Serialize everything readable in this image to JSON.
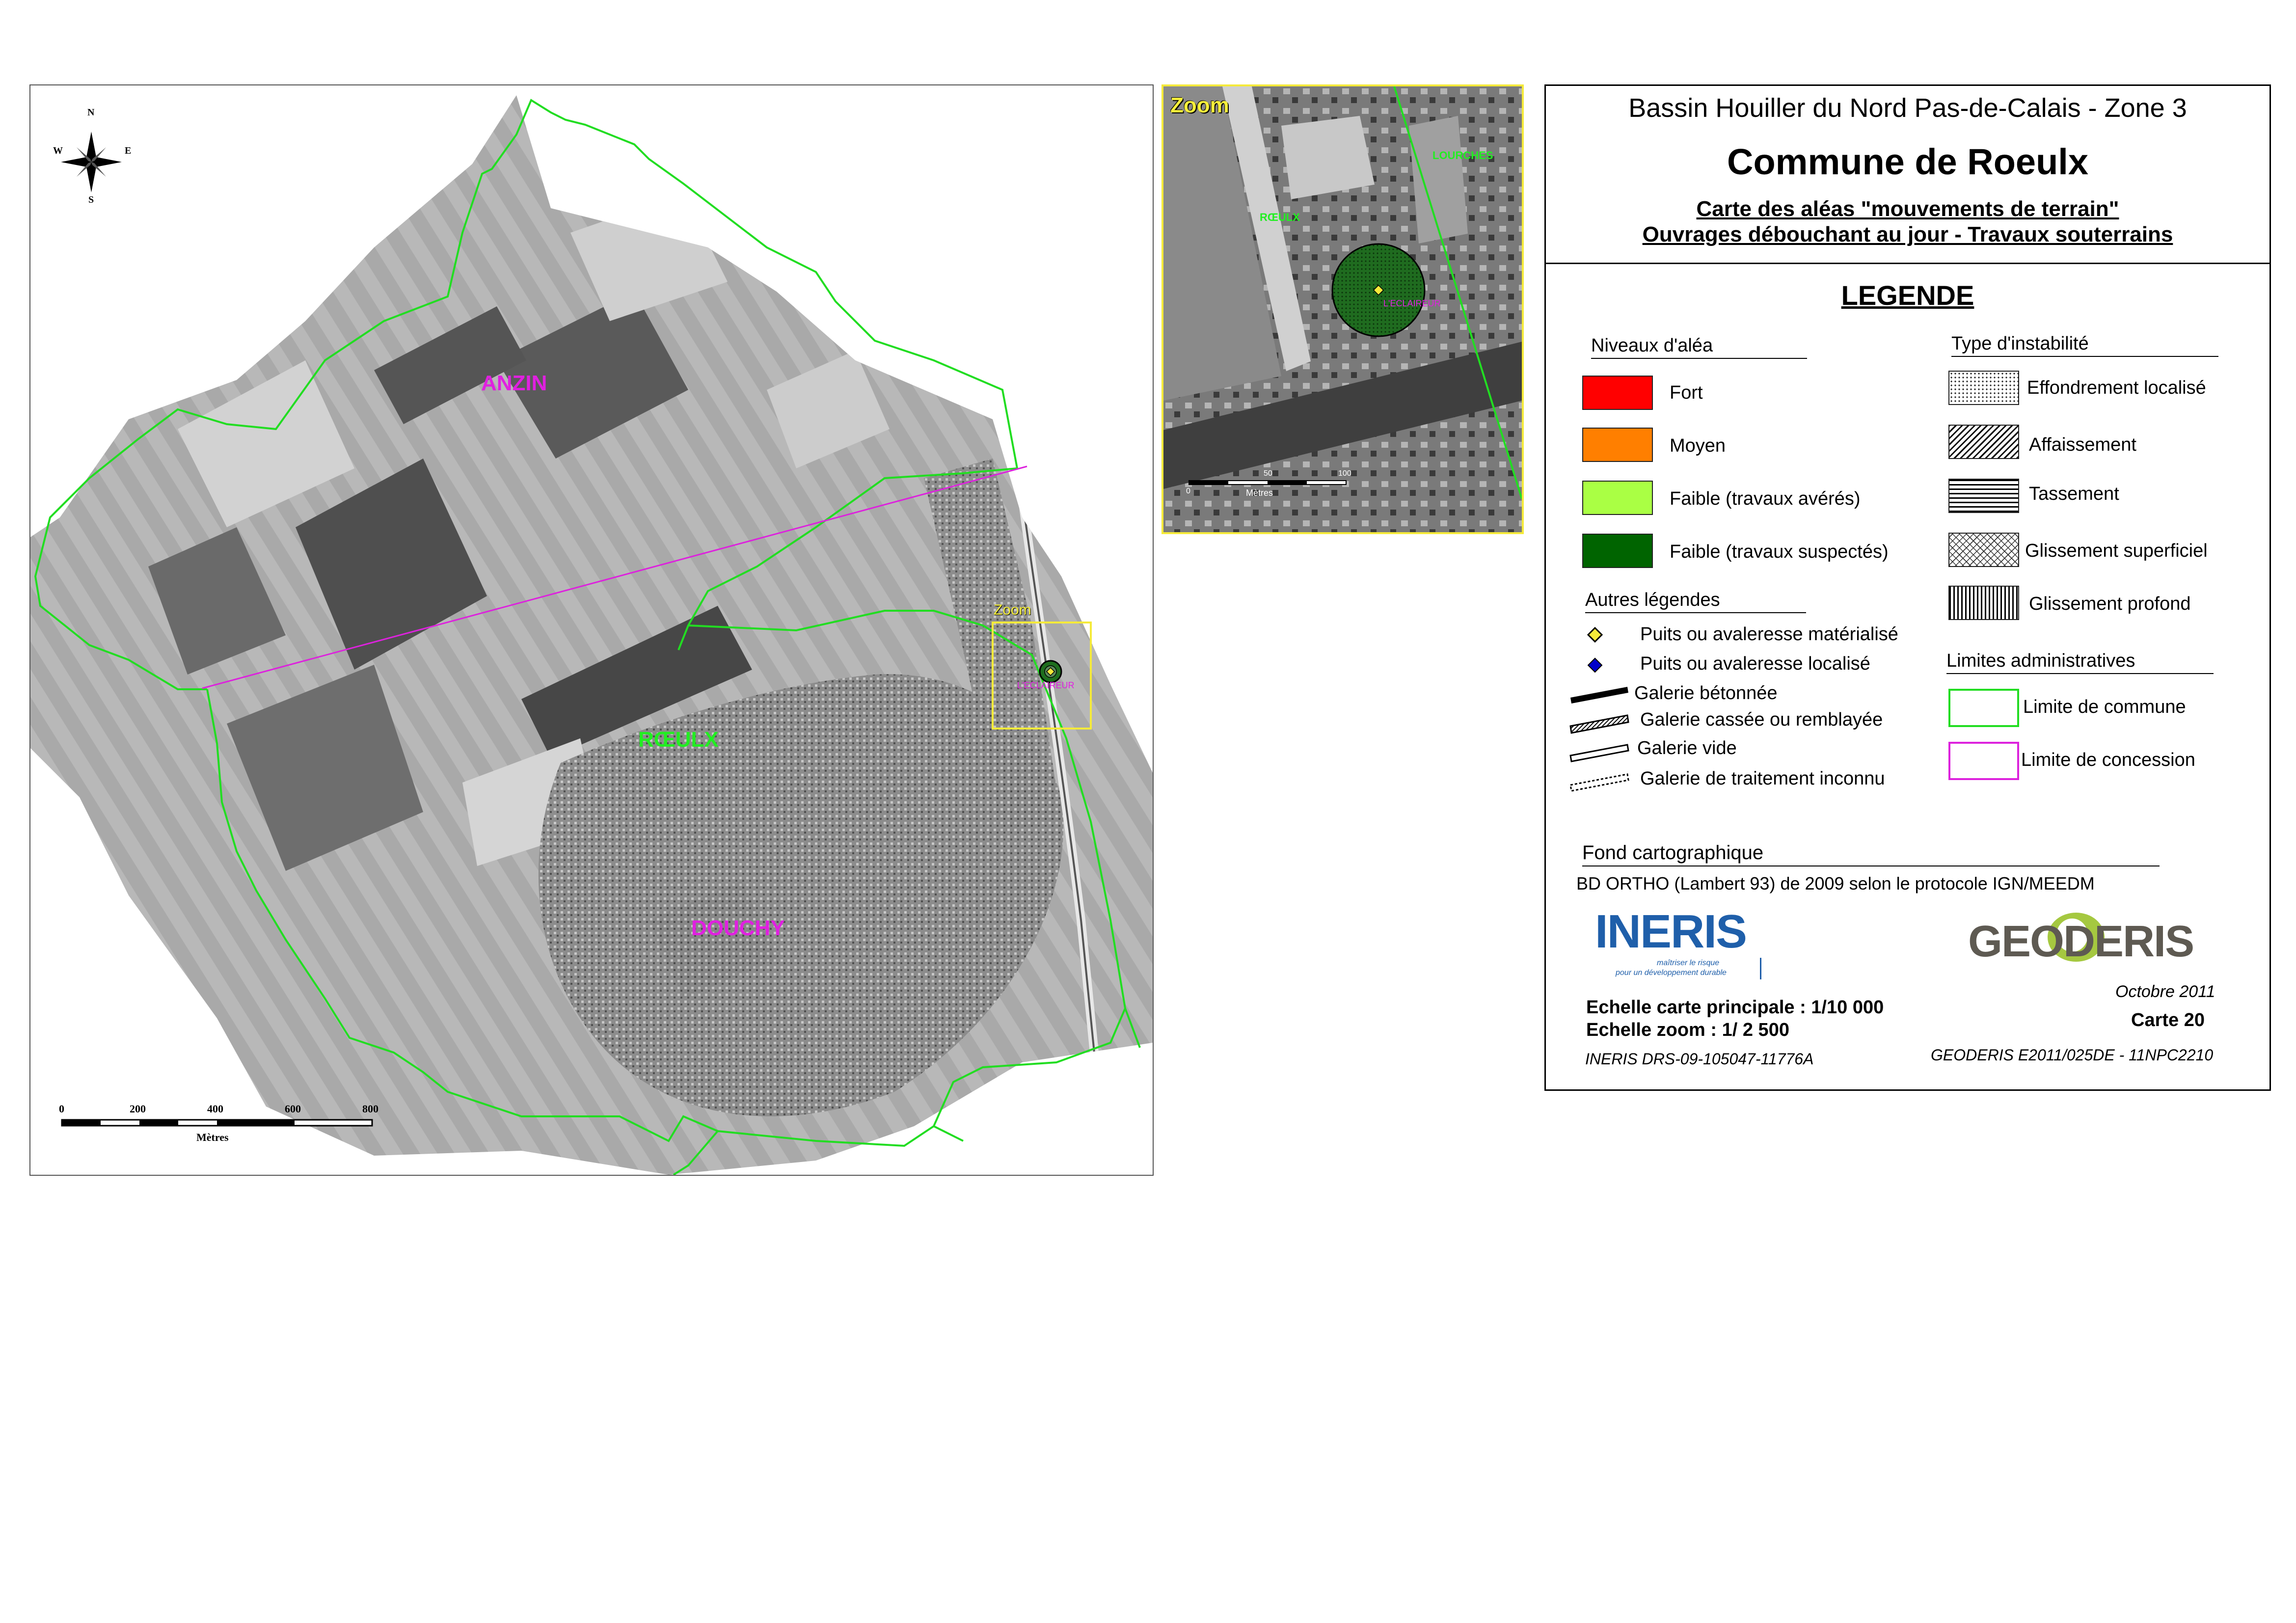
{
  "title_block": {
    "line1": "Bassin Houiller du Nord Pas-de-Calais - Zone 3",
    "line2": "Commune de Roeulx",
    "line3": "Carte des aléas \"mouvements de terrain\"",
    "line4": "Ouvrages débouchant au jour - Travaux souterrains"
  },
  "legend": {
    "heading": "LEGENDE",
    "niveaux_title": "Niveaux d'aléa",
    "niveaux": [
      {
        "label": "Fort",
        "color": "#ff0000"
      },
      {
        "label": "Moyen",
        "color": "#ff7f00"
      },
      {
        "label": "Faible (travaux avérés)",
        "color": "#aaff44"
      },
      {
        "label": "Faible (travaux suspectés)",
        "color": "#006400"
      }
    ],
    "instabilite_title": "Type d'instabilité",
    "instabilite": [
      {
        "label": "Effondrement  localisé",
        "pattern": "dots"
      },
      {
        "label": "Affaissement",
        "pattern": "diagonal-hatch"
      },
      {
        "label": "Tassement",
        "pattern": "horizontal-hatch"
      },
      {
        "label": "Glissement superficiel",
        "pattern": "cross-hatch"
      },
      {
        "label": "Glissement profond",
        "pattern": "vertical-hatch"
      }
    ],
    "autres_title": "Autres légendes",
    "autres": [
      {
        "label": "Puits ou avaleresse matérialisé",
        "icon": "yellow-diamond-icon"
      },
      {
        "label": "Puits ou avaleresse localisé",
        "icon": "blue-diamond-icon"
      },
      {
        "label": "Galerie bétonnée",
        "icon": "thick-black-line-icon"
      },
      {
        "label": "Galerie cassée ou remblayée",
        "icon": "hatched-line-icon"
      },
      {
        "label": "Galerie vide",
        "icon": "hollow-line-icon"
      },
      {
        "label": "Galerie de traitement inconnu",
        "icon": "dotted-line-icon"
      }
    ],
    "limites_title": "Limites administratives",
    "limites": [
      {
        "label": "Limite de commune",
        "color": "#22dd22"
      },
      {
        "label": "Limite de concession",
        "color": "#dd22dd"
      }
    ]
  },
  "fond": {
    "title": "Fond cartographique",
    "text": "BD ORTHO (Lambert 93) de 2009 selon le protocole IGN/MEEDM"
  },
  "logos": {
    "ineris": "INERIS",
    "ineris_tagline1": "maîtriser le risque",
    "ineris_tagline2": "pour un développement durable",
    "geoderis": "GEODERIS"
  },
  "footer": {
    "echelle_main": "Echelle carte principale : 1/10 000",
    "echelle_zoom": "Echelle zoom : 1/ 2 500",
    "ineris_ref": "INERIS DRS-09-105047-11776A",
    "date": "Octobre 2011",
    "carte": "Carte 20",
    "geoderis_ref": "GEODERIS E2011/025DE - 11NPC2210"
  },
  "main_map": {
    "communes": [
      "ANZIN",
      "RŒULX",
      "DOUCHY"
    ],
    "zoom_label": "Zoom",
    "site_label": "L'ECLAIREUR",
    "compass": {
      "n": "N",
      "s": "S",
      "e": "E",
      "w": "W"
    },
    "scale_ticks": [
      "0",
      "200",
      "400",
      "600",
      "800"
    ],
    "scale_unit": "Mètres"
  },
  "zoom_map": {
    "title": "Zoom",
    "labels": [
      "RŒULX",
      "LOURCHES"
    ],
    "site_label": "L'ECLAIREUR",
    "scale_unit": "Mètres",
    "scale_ticks": [
      "0",
      "50",
      "100"
    ]
  },
  "colors": {
    "commune_boundary": "#22dd22",
    "concession_boundary": "#dd22dd",
    "commune_label_magenta": "#e020e0",
    "commune_label_green": "#22ee22",
    "zoom_frame": "#f5ea3a"
  }
}
